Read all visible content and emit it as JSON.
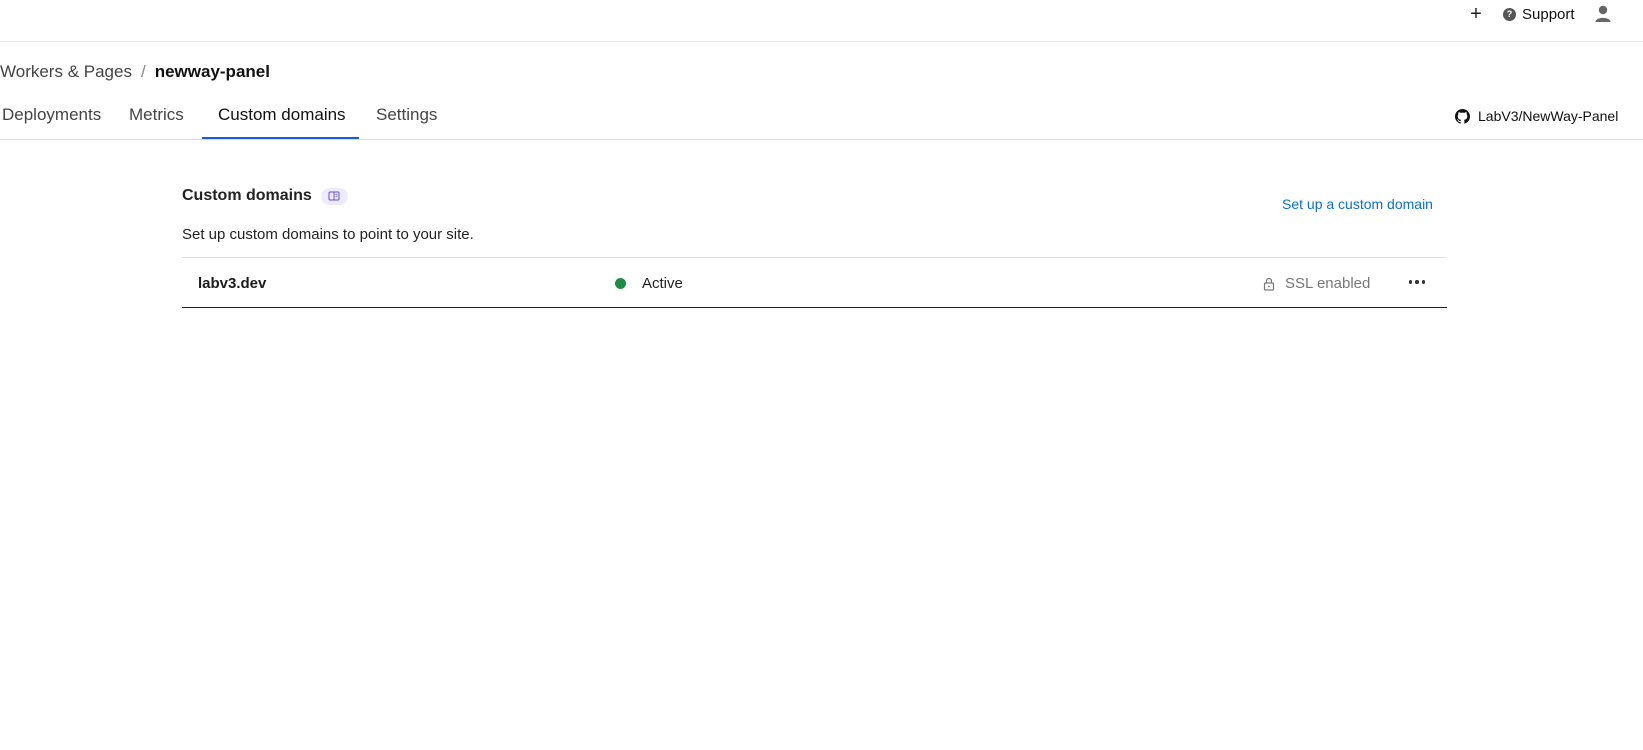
{
  "topbar": {
    "add_label": "+",
    "support_label": "Support",
    "support_icon": "?"
  },
  "breadcrumb": {
    "parent": "Workers & Pages",
    "separator": "/",
    "current": "newway-panel"
  },
  "tabs": [
    {
      "label": "Deployments",
      "active": false
    },
    {
      "label": "Metrics",
      "active": false
    },
    {
      "label": "Custom domains",
      "active": true
    },
    {
      "label": "Settings",
      "active": false
    }
  ],
  "repo": {
    "label": "LabV3/NewWay-Panel"
  },
  "section": {
    "title": "Custom domains",
    "description": "Set up custom domains to point to your site.",
    "setup_link": "Set up a custom domain"
  },
  "domains": [
    {
      "name": "labv3.dev",
      "status": "Active",
      "ssl": "SSL enabled"
    }
  ],
  "colors": {
    "accent": "#1f5bd8",
    "link": "#0a6fd8",
    "status_active": "#1e8c46",
    "badge_bg": "#eeeaff"
  }
}
